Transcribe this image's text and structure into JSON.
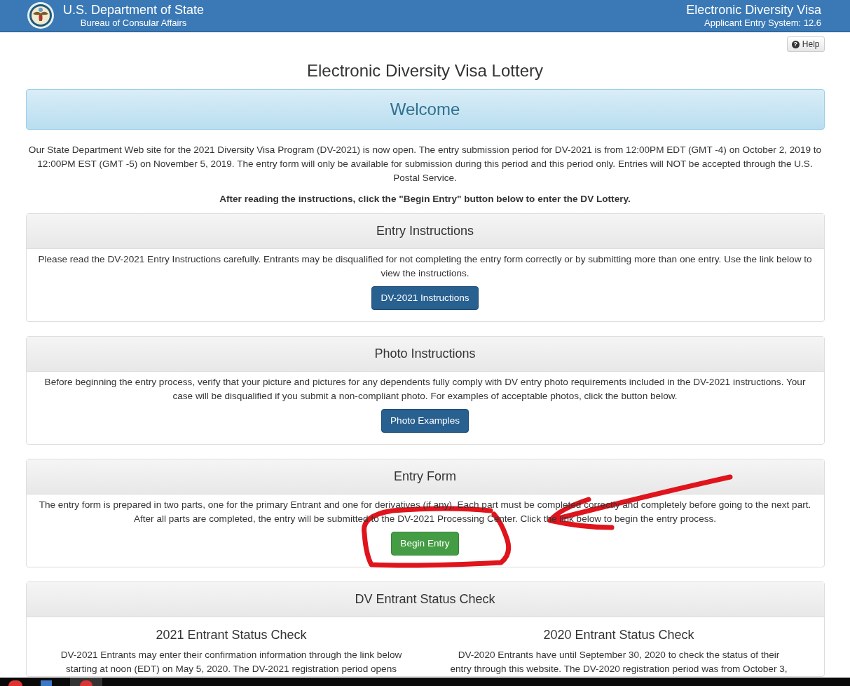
{
  "header": {
    "agency": "U.S. Department of State",
    "bureau": "Bureau of Consular Affairs",
    "system": "Electronic Diversity Visa",
    "version": "Applicant Entry System: 12.6"
  },
  "help_button": {
    "icon": "?",
    "label": "Help"
  },
  "page_title": "Electronic Diversity Visa Lottery",
  "welcome": "Welcome",
  "intro": "Our State Department Web site for the 2021 Diversity Visa Program (DV-2021) is now open. The entry submission period for DV-2021 is from 12:00PM EDT (GMT -4) on October 2, 2019 to 12:00PM EST (GMT -5) on November 5, 2019. The entry form will only be available for submission during this period and this period only. Entries will NOT be accepted through the U.S. Postal Service.",
  "instruction_note": "After reading the instructions, click the \"Begin Entry\" button below to enter the DV Lottery.",
  "panels": [
    {
      "kind": "button",
      "title": "Entry Instructions",
      "text": "Please read the DV-2021 Entry Instructions carefully. Entrants may be disqualified for not completing the entry form correctly or by submitting more than one entry. Use the link below to view the instructions.",
      "button": {
        "label": "DV-2021 Instructions"
      }
    },
    {
      "kind": "button",
      "title": "Photo Instructions",
      "text": "Before beginning the entry process, verify that your picture and pictures for any dependents fully comply with DV entry photo requirements included in the DV-2021 instructions. Your case will be disqualified if you submit a non-compliant photo.  For examples of acceptable photos, click the button below.",
      "button": {
        "label": "Photo Examples"
      }
    },
    {
      "kind": "button",
      "title": "Entry Form",
      "text": "The entry form is prepared in two parts, one for the primary Entrant and one for derivatives (if any). Each part must be completed correctly and completely before going to the next part. After all parts are completed, the entry will be submitted to the DV-2021 Processing Center. Click the link below to begin the entry process.",
      "button": {
        "label": "Begin Entry"
      }
    },
    {
      "kind": "columns",
      "title": "DV Entrant Status Check",
      "columns": [
        {
          "title": "2021 Entrant Status Check",
          "text": "DV-2021 Entrants may enter their confirmation information through the link below starting at noon (EDT) on May 5, 2020. The DV-2021 registration period opens"
        },
        {
          "title": "2020 Entrant Status Check",
          "text": "DV-2020 Entrants have until September 30, 2020 to check the status of their entry through this website. The DV-2020 registration period was from October 3,"
        }
      ]
    }
  ]
}
